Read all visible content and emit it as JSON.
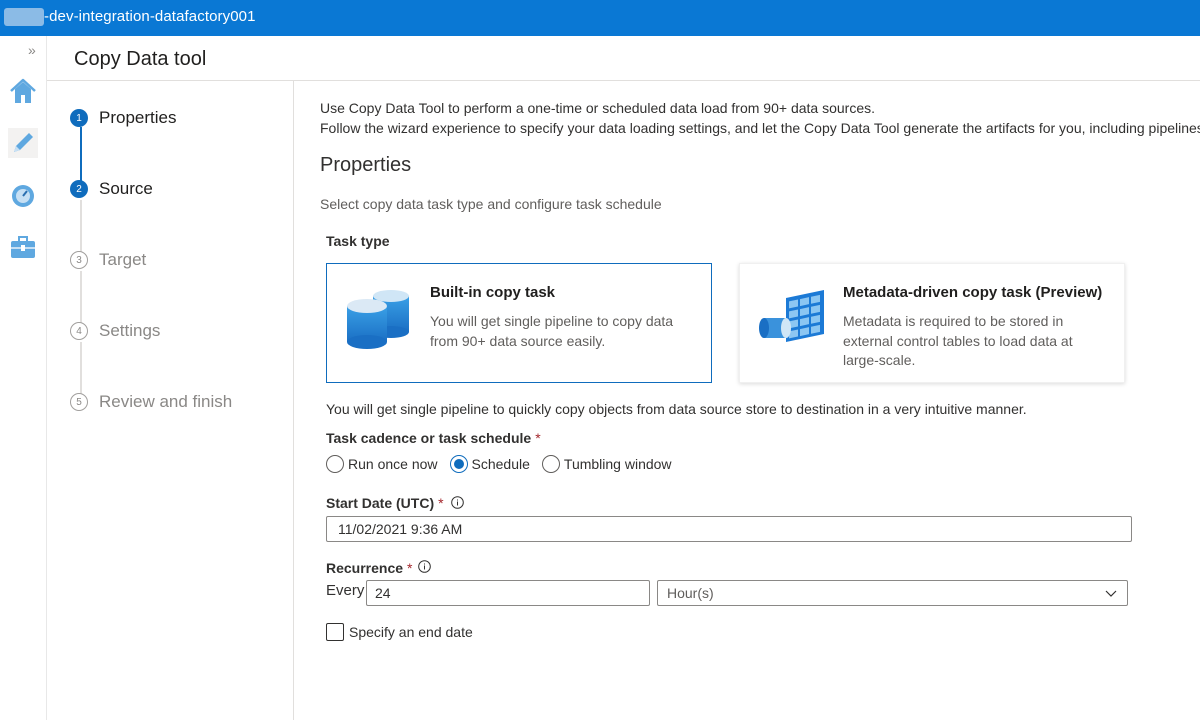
{
  "topbar": {
    "title": "-dev-integration-datafactory001"
  },
  "leftrail": {
    "expand_glyph": "»",
    "icons": [
      "home-icon",
      "pencil-author-icon",
      "monitor-gauge-icon",
      "toolbox-manage-icon"
    ]
  },
  "header": {
    "title": "Copy Data tool"
  },
  "steps": [
    {
      "number": "1",
      "label": "Properties",
      "state": "active"
    },
    {
      "number": "2",
      "label": "Source",
      "state": "active"
    },
    {
      "number": "3",
      "label": "Target",
      "state": "inactive"
    },
    {
      "number": "4",
      "label": "Settings",
      "state": "inactive"
    },
    {
      "number": "5",
      "label": "Review and finish",
      "state": "inactive"
    }
  ],
  "main": {
    "intro_line1": "Use Copy Data Tool to perform a one-time or scheduled data load from 90+ data sources.",
    "intro_line2": "Follow the wizard experience to specify your data loading settings, and let the Copy Data Tool generate the artifacts for you, including pipelines",
    "heading": "Properties",
    "subheading": "Select copy data task type and configure task schedule",
    "task_type_label": "Task type",
    "cards": [
      {
        "title": "Built-in copy task",
        "description": "You will get single pipeline to copy data from 90+ data source easily.",
        "icon": "database-cylinders-icon",
        "selected": true
      },
      {
        "title": "Metadata-driven copy task (Preview)",
        "description": "Metadata is required to be stored in external control tables to load data at large-scale.",
        "icon": "metadata-table-icon",
        "selected": false
      }
    ],
    "task_description": "You will get single pipeline to quickly copy objects from data source store to destination in a very intuitive manner.",
    "cadence_label": "Task cadence or task schedule",
    "required_mark": "*",
    "cadence_options": [
      {
        "label": "Run once now",
        "checked": false
      },
      {
        "label": "Schedule",
        "checked": true
      },
      {
        "label": "Tumbling window",
        "checked": false
      }
    ],
    "start_date_label": "Start Date (UTC)",
    "start_date_value": "11/02/2021 9:36 AM",
    "recurrence_label": "Recurrence",
    "every_label": "Every",
    "recurrence_value": "24",
    "recurrence_unit": "Hour(s)",
    "end_date_label": "Specify an end date",
    "end_date_checked": false
  },
  "colors": {
    "topbar": "#0a78d4",
    "accent": "#0f6cbd",
    "required": "#a4262c"
  }
}
